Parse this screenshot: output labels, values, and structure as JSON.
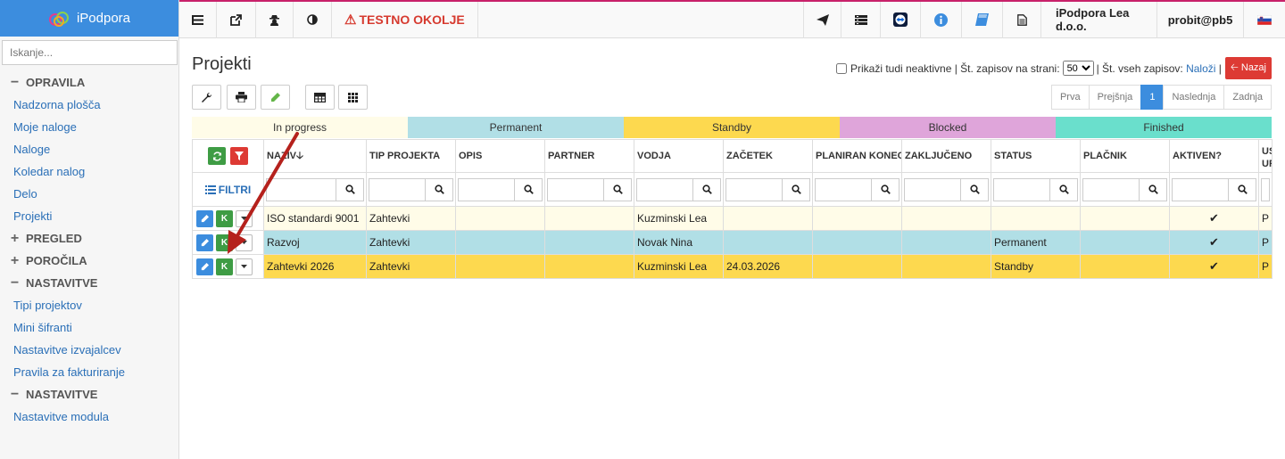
{
  "app": {
    "name": "iPodpora",
    "environment_label": "TESTNO OKOLJE",
    "company": "iPodpora Lea d.o.o.",
    "user": "probit@pb5"
  },
  "sidebar": {
    "search_placeholder": "Iskanje...",
    "sections": [
      {
        "label": "OPRAVILA",
        "sym": "−",
        "items": [
          "Nadzorna plošča",
          "Moje naloge",
          "Naloge",
          "Koledar nalog",
          "Delo",
          "Projekti"
        ]
      },
      {
        "label": "PREGLED",
        "sym": "+",
        "items": []
      },
      {
        "label": "POROČILA",
        "sym": "+",
        "items": []
      },
      {
        "label": "NASTAVITVE",
        "sym": "−",
        "items": [
          "Tipi projektov",
          "Mini šifranti",
          "Nastavitve izvajalcev",
          "Pravila za fakturiranje"
        ]
      },
      {
        "label": "NASTAVITVE",
        "sym": "−",
        "items": [
          "Nastavitve modula"
        ]
      }
    ]
  },
  "page": {
    "title": "Projekti",
    "show_inactive_label": "Prikaži tudi neaktivne",
    "per_page_label": "| Št. zapisov na strani:",
    "per_page_value": "50",
    "total_label": "| Št. vseh zapisov:",
    "load_link": "Naloži",
    "sep": "|",
    "back_button": "Nazaj"
  },
  "pager": {
    "first": "Prva",
    "prev": "Prejšnja",
    "current": "1",
    "next": "Naslednja",
    "last": "Zadnja"
  },
  "legend": [
    {
      "label": "In progress",
      "color": "#fffce8"
    },
    {
      "label": "Permanent",
      "color": "#b1dfe6"
    },
    {
      "label": "Standby",
      "color": "#fdd94f"
    },
    {
      "label": "Blocked",
      "color": "#dfa5da"
    },
    {
      "label": "Finished",
      "color": "#6adfcc"
    }
  ],
  "table": {
    "filter_label": "FILTRI",
    "columns": [
      "NAZIV",
      "TIP PROJEKTA",
      "OPIS",
      "PARTNER",
      "VODJA",
      "ZAČETEK",
      "PLANIRAN KONEC",
      "ZAKLJUČENO",
      "STATUS",
      "PLAČNIK",
      "AKTIVEN?",
      "US"
    ],
    "last_col_line2": "UR",
    "sort_arrow": "🡣",
    "rows": [
      {
        "naziv": "ISO standardi 9001",
        "tip": "Zahtevki",
        "opis": "",
        "partner": "",
        "vodja": "Kuzminski Lea",
        "zacetek": "",
        "konec": "",
        "zakljuceno": "",
        "status": "",
        "placnik": "",
        "aktiven": "✔",
        "us": "P"
      },
      {
        "naziv": "Razvoj",
        "tip": "Zahtevki",
        "opis": "",
        "partner": "",
        "vodja": "Novak Nina",
        "zacetek": "",
        "konec": "",
        "zakljuceno": "",
        "status": "Permanent",
        "placnik": "",
        "aktiven": "✔",
        "us": "P"
      },
      {
        "naziv": "Zahtevki 2026",
        "tip": "Zahtevki",
        "opis": "",
        "partner": "",
        "vodja": "Kuzminski Lea",
        "zacetek": "24.03.2026",
        "konec": "",
        "zakljuceno": "",
        "status": "Standby",
        "placnik": "",
        "aktiven": "✔",
        "us": "P"
      }
    ],
    "row_action_k": "K"
  },
  "icons": [
    "menu-lines-icon",
    "external-link-icon",
    "user-secret-icon",
    "contrast-icon",
    "warning-icon",
    "paper-plane-icon",
    "server-icon",
    "teamviewer-icon",
    "info-icon",
    "book-icon",
    "document-icon",
    "flag-si-icon",
    "wrench-icon",
    "print-icon",
    "pencil-icon",
    "table-icon",
    "grid-icon",
    "refresh-icon",
    "filter-icon",
    "search-icon",
    "check-icon"
  ],
  "colors": {
    "brand": "#3c8dde",
    "danger": "#dd3a34",
    "annotation_arrow": "#b5211c"
  }
}
